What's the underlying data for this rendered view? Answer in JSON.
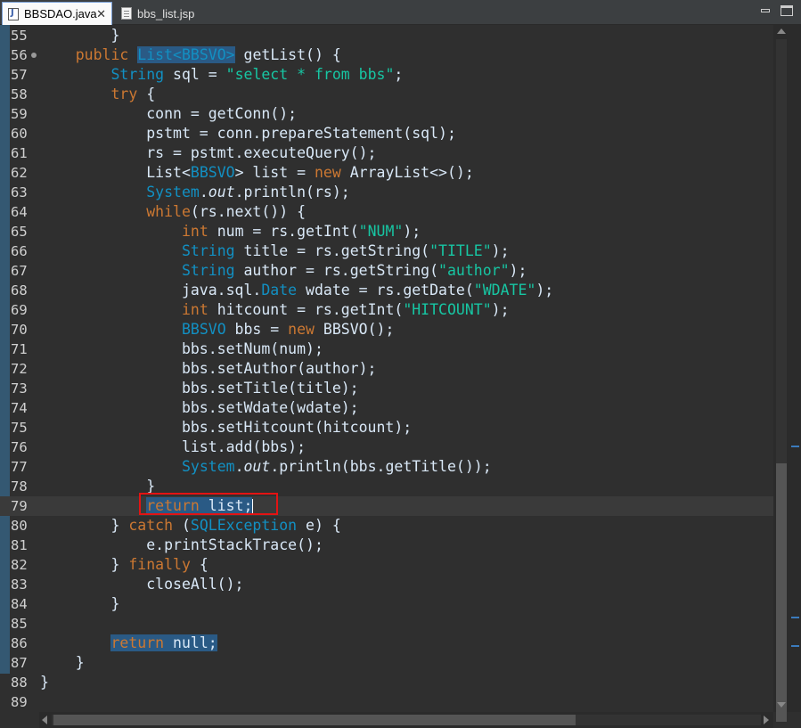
{
  "tabs": [
    {
      "label": "BBSDAO.java",
      "close": "✕"
    },
    {
      "label": "bbs_list.jsp"
    }
  ],
  "lines": [
    {
      "num": "55",
      "tokens": [
        {
          "t": "        }"
        }
      ]
    },
    {
      "num": "56",
      "tokens": [
        {
          "t": "    "
        },
        {
          "t": "public",
          "c": "kw"
        },
        {
          "t": " "
        },
        {
          "t": "List<",
          "c": "ty",
          "h": true
        },
        {
          "t": "BBSVO",
          "c": "ty",
          "h": true
        },
        {
          "t": ">",
          "c": "ty",
          "h": true
        },
        {
          "t": " getList() {"
        }
      ]
    },
    {
      "num": "57",
      "tokens": [
        {
          "t": "        "
        },
        {
          "t": "String",
          "c": "ty"
        },
        {
          "t": " sql = "
        },
        {
          "t": "\"select * from bbs\"",
          "c": "st"
        },
        {
          "t": ";"
        }
      ]
    },
    {
      "num": "58",
      "tokens": [
        {
          "t": "        "
        },
        {
          "t": "try",
          "c": "kw"
        },
        {
          "t": " {"
        }
      ]
    },
    {
      "num": "59",
      "tokens": [
        {
          "t": "            conn = getConn();"
        }
      ]
    },
    {
      "num": "60",
      "tokens": [
        {
          "t": "            pstmt = conn.prepareStatement(sql);"
        }
      ]
    },
    {
      "num": "61",
      "tokens": [
        {
          "t": "            rs = pstmt.executeQuery();"
        }
      ]
    },
    {
      "num": "62",
      "tokens": [
        {
          "t": "            List<"
        },
        {
          "t": "BBSVO",
          "c": "ty"
        },
        {
          "t": "> list = "
        },
        {
          "t": "new",
          "c": "kw"
        },
        {
          "t": " ArrayList<>();"
        }
      ]
    },
    {
      "num": "63",
      "tokens": [
        {
          "t": "            "
        },
        {
          "t": "System",
          "c": "ty"
        },
        {
          "t": "."
        },
        {
          "t": "out",
          "c": "it"
        },
        {
          "t": ".println(rs);"
        }
      ]
    },
    {
      "num": "64",
      "tokens": [
        {
          "t": "            "
        },
        {
          "t": "while",
          "c": "kw"
        },
        {
          "t": "(rs.next()) {"
        }
      ]
    },
    {
      "num": "65",
      "tokens": [
        {
          "t": "                "
        },
        {
          "t": "int",
          "c": "kw"
        },
        {
          "t": " num = rs.getInt("
        },
        {
          "t": "\"NUM\"",
          "c": "st"
        },
        {
          "t": ");"
        }
      ]
    },
    {
      "num": "66",
      "tokens": [
        {
          "t": "                "
        },
        {
          "t": "String",
          "c": "ty"
        },
        {
          "t": " title = rs.getString("
        },
        {
          "t": "\"TITLE\"",
          "c": "st"
        },
        {
          "t": ");"
        }
      ]
    },
    {
      "num": "67",
      "tokens": [
        {
          "t": "                "
        },
        {
          "t": "String",
          "c": "ty"
        },
        {
          "t": " author = rs.getString("
        },
        {
          "t": "\"author\"",
          "c": "st"
        },
        {
          "t": ");"
        }
      ]
    },
    {
      "num": "68",
      "tokens": [
        {
          "t": "                java.sql."
        },
        {
          "t": "Date",
          "c": "ty"
        },
        {
          "t": " wdate = rs.getDate("
        },
        {
          "t": "\"WDATE\"",
          "c": "st"
        },
        {
          "t": ");"
        }
      ]
    },
    {
      "num": "69",
      "tokens": [
        {
          "t": "                "
        },
        {
          "t": "int",
          "c": "kw"
        },
        {
          "t": " hitcount = rs.getInt("
        },
        {
          "t": "\"HITCOUNT\"",
          "c": "st"
        },
        {
          "t": ");"
        }
      ]
    },
    {
      "num": "70",
      "tokens": [
        {
          "t": "                "
        },
        {
          "t": "BBSVO",
          "c": "ty"
        },
        {
          "t": " bbs = "
        },
        {
          "t": "new",
          "c": "kw"
        },
        {
          "t": " BBSVO();"
        }
      ]
    },
    {
      "num": "71",
      "tokens": [
        {
          "t": "                bbs.setNum(num);"
        }
      ]
    },
    {
      "num": "72",
      "tokens": [
        {
          "t": "                bbs.setAuthor(author);"
        }
      ]
    },
    {
      "num": "73",
      "tokens": [
        {
          "t": "                bbs.setTitle(title);"
        }
      ]
    },
    {
      "num": "74",
      "tokens": [
        {
          "t": "                bbs.setWdate(wdate);"
        }
      ]
    },
    {
      "num": "75",
      "tokens": [
        {
          "t": "                bbs.setHitcount(hitcount);"
        }
      ]
    },
    {
      "num": "76",
      "tokens": [
        {
          "t": "                list.add(bbs);"
        }
      ]
    },
    {
      "num": "77",
      "tokens": [
        {
          "t": "                "
        },
        {
          "t": "System",
          "c": "ty"
        },
        {
          "t": "."
        },
        {
          "t": "out",
          "c": "it"
        },
        {
          "t": ".println(bbs.getTitle());"
        }
      ]
    },
    {
      "num": "78",
      "tokens": [
        {
          "t": "            }"
        }
      ]
    },
    {
      "num": "79",
      "current": true,
      "tokens": [
        {
          "t": "            "
        },
        {
          "t": "return",
          "c": "kw",
          "h": true
        },
        {
          "t": " list;",
          "h": true
        }
      ]
    },
    {
      "num": "80",
      "tokens": [
        {
          "t": "        } "
        },
        {
          "t": "catch",
          "c": "kw"
        },
        {
          "t": " ("
        },
        {
          "t": "SQLException",
          "c": "ty"
        },
        {
          "t": " e) {"
        }
      ]
    },
    {
      "num": "81",
      "tokens": [
        {
          "t": "            e.printStackTrace();"
        }
      ]
    },
    {
      "num": "82",
      "tokens": [
        {
          "t": "        } "
        },
        {
          "t": "finally",
          "c": "kw"
        },
        {
          "t": " {"
        }
      ]
    },
    {
      "num": "83",
      "tokens": [
        {
          "t": "            closeAll();"
        }
      ]
    },
    {
      "num": "84",
      "tokens": [
        {
          "t": "        }"
        }
      ]
    },
    {
      "num": "85",
      "tokens": [
        {
          "t": ""
        }
      ]
    },
    {
      "num": "86",
      "tokens": [
        {
          "t": "        "
        },
        {
          "t": "return",
          "c": "kw",
          "h": true
        },
        {
          "t": " null;",
          "h": true
        }
      ]
    },
    {
      "num": "87",
      "tokens": [
        {
          "t": "    }"
        }
      ]
    },
    {
      "num": "88",
      "tokens": [
        {
          "t": "}"
        }
      ]
    },
    {
      "num": "89",
      "tokens": [
        {
          "t": ""
        }
      ]
    }
  ],
  "colors": {
    "keyword": "#cc7832",
    "type": "#1290c3",
    "string": "#17c6a3",
    "highlight": "#2a5a85",
    "annotation_box": "#e31313"
  }
}
